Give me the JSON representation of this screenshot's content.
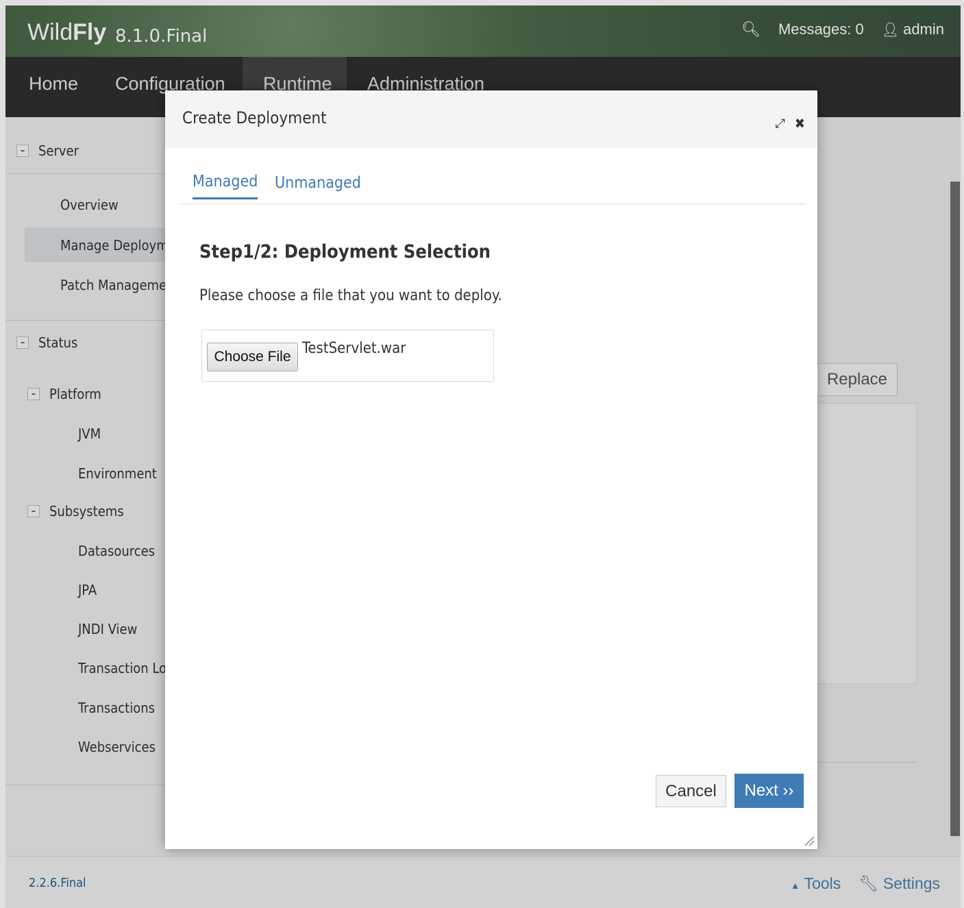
{
  "header": {
    "brand_light": "Wild",
    "brand_bold": "Fly",
    "version": "8.1.0.Final",
    "messages": "Messages: 0",
    "user": "admin"
  },
  "nav": {
    "items": [
      "Home",
      "Configuration",
      "Runtime",
      "Administration"
    ]
  },
  "sidebar": {
    "server": "Server",
    "overview": "Overview",
    "manage_deployments": "Manage Deployments",
    "patch_management": "Patch Management",
    "status": "Status",
    "platform": "Platform",
    "jvm": "JVM",
    "environment": "Environment",
    "subsystems": "Subsystems",
    "datasources": "Datasources",
    "jpa": "JPA",
    "jndi_view": "JNDI View",
    "transaction_logs": "Transaction Logs",
    "transactions": "Transactions",
    "webservices": "Webservices"
  },
  "main": {
    "replace_label": "Replace"
  },
  "footer": {
    "version": "2.2.6.Final",
    "tools": "Tools",
    "settings": "Settings"
  },
  "modal": {
    "title": "Create Deployment",
    "tabs": [
      "Managed",
      "Unmanaged"
    ],
    "step_title": "Step1/2: Deployment Selection",
    "step_desc": "Please choose a file that you want to deploy.",
    "choose_file_label": "Choose File",
    "file_name": "TestServlet.war",
    "cancel_label": "Cancel",
    "next_label": "Next ››"
  },
  "colors": {
    "accent": "#3f7bb5",
    "nav_bg": "#2f2f2f",
    "header_green": "#4c6a4a"
  }
}
